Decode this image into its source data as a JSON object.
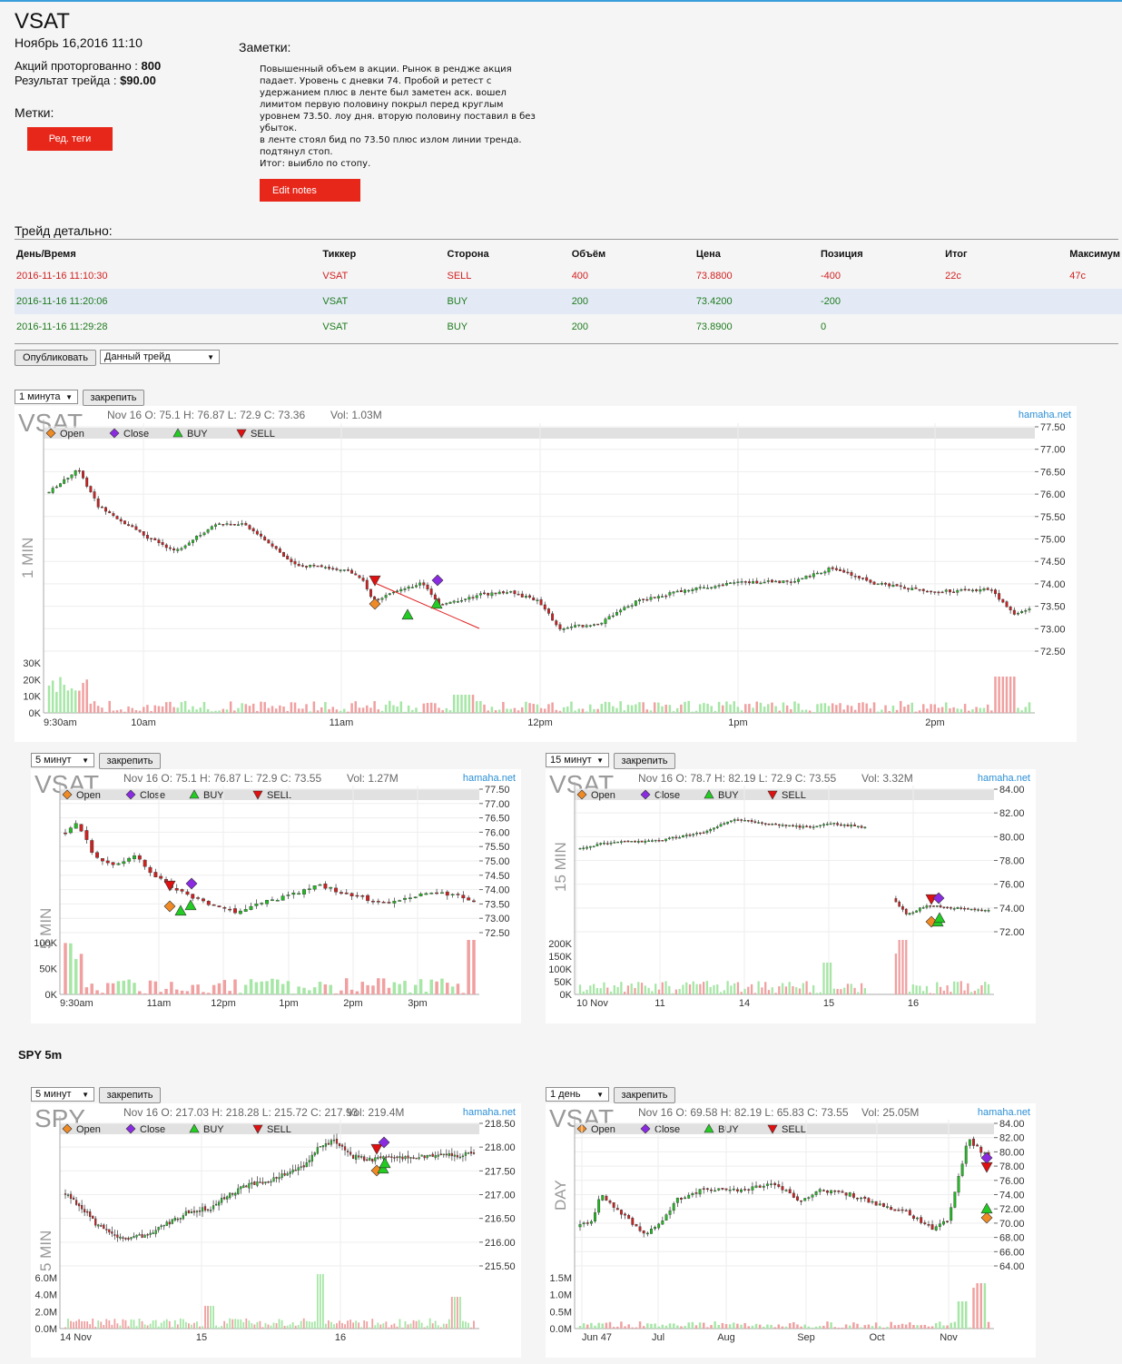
{
  "header": {
    "ticker": "VSAT",
    "datetime": "Ноябрь 16,2016 11:10",
    "shares_label": "Акций проторгованно : ",
    "shares_value": "800",
    "result_label": "Результат трейда : ",
    "result_value": "$90.00",
    "tags_label": "Метки:",
    "edit_tags_button": "Ред. теги"
  },
  "notes": {
    "label": "Заметки:",
    "lines": [
      "Повышенный объем в акции. Рынок в рендже акция",
      "падает. Уровень с дневки 74. Пробой и ретест с",
      "удержанием плюс в ленте был заметен аск. вошел",
      "лимитом первую половину покрыл перед круглым",
      "уровнем 73.50. лоу дня. вторую половину поставил в без",
      "убыток.",
      "в ленте стоял бид по 73.50 плюс излом линии тренда.",
      "подтянул стоп.",
      "Итог: выибло по стопу."
    ],
    "edit_button": "Edit notes"
  },
  "trades": {
    "title": "Трейд детально:",
    "columns": [
      "День/Время",
      "Тиккер",
      "Сторона",
      "Объём",
      "Цена",
      "Позиция",
      "Итог",
      "Максимум"
    ],
    "rows": [
      [
        "2016-11-16 11:10:30",
        "VSAT",
        "SELL",
        "400",
        "73.8800",
        "-400",
        "22c",
        "47c"
      ],
      [
        "2016-11-16 11:20:06",
        "VSAT",
        "BUY",
        "200",
        "73.4200",
        "-200",
        "",
        ""
      ],
      [
        "2016-11-16 11:29:28",
        "VSAT",
        "BUY",
        "200",
        "73.8900",
        "0",
        "",
        ""
      ]
    ]
  },
  "toolbar": {
    "publish_button": "Опубликовать",
    "scope_select": "Данный трейд"
  },
  "pin_label": "закрепить",
  "spy_heading": "SPY 5m",
  "legend": {
    "open": "Open",
    "close": "Close",
    "buy": "BUY",
    "sell": "SELL"
  },
  "colors": {
    "accent_red": "#e8271b",
    "sell": "#d21f1f",
    "buy": "#1e7b1e",
    "candle_up": "#22bb22",
    "candle_down": "#cc2222",
    "brand": "#2a8fd6"
  },
  "charts": [
    {
      "id": "c1",
      "interval": "1 минута",
      "symbol": "VSAT",
      "tf_label": "1 MIN",
      "info": "Nov 16 O: 75.1 H: 76.87 L: 72.9 C: 73.36",
      "vol": "Vol: 1.03M",
      "watermark": "hamaha.net",
      "y_ticks": [
        "77.50",
        "77.00",
        "76.50",
        "76.00",
        "75.50",
        "75.00",
        "74.50",
        "74.00",
        "73.50",
        "73.00",
        "72.50"
      ],
      "vol_ticks": [
        "30K",
        "20K",
        "10K",
        "0K"
      ],
      "x_ticks": [
        "9:30am",
        "10am",
        "11am",
        "12pm",
        "1pm",
        "2pm"
      ]
    },
    {
      "id": "c2",
      "interval": "5 минут",
      "symbol": "VSAT",
      "tf_label": "5 MIN",
      "info": "Nov 16 O: 75.1 H: 76.87 L: 72.9 C: 73.55",
      "vol": "Vol: 1.27M",
      "watermark": "hamaha.net",
      "y_ticks": [
        "77.50",
        "77.00",
        "76.50",
        "76.00",
        "75.50",
        "75.00",
        "74.50",
        "74.00",
        "73.50",
        "73.00",
        "72.50"
      ],
      "vol_ticks": [
        "100K",
        "50K",
        "0K"
      ],
      "x_ticks": [
        "9:30am",
        "11am",
        "12pm",
        "1pm",
        "2pm",
        "3pm"
      ]
    },
    {
      "id": "c3",
      "interval": "15 минут",
      "symbol": "VSAT",
      "tf_label": "15 MIN",
      "info": "Nov 16 O: 78.7 H: 82.19 L: 72.9 C: 73.55",
      "vol": "Vol: 3.32M",
      "watermark": "hamaha.net",
      "y_ticks": [
        "84.00",
        "82.00",
        "80.00",
        "78.00",
        "76.00",
        "74.00",
        "72.00"
      ],
      "vol_ticks": [
        "200K",
        "150K",
        "100K",
        "50K",
        "0K"
      ],
      "x_ticks": [
        "10 Nov",
        "11",
        "14",
        "15",
        "16"
      ]
    },
    {
      "id": "c4",
      "interval": "5 минут",
      "symbol": "SPY",
      "tf_label": "5 MIN",
      "info": "Nov 16 O: 217.03 H: 218.28 L: 215.72 C: 217.93",
      "vol": "Vol: 219.4M",
      "watermark": "hamaha.net",
      "y_ticks": [
        "218.50",
        "218.00",
        "217.50",
        "217.00",
        "216.50",
        "216.00",
        "215.50"
      ],
      "vol_ticks": [
        "6.0M",
        "4.0M",
        "2.0M",
        "0.0M"
      ],
      "x_ticks": [
        "14 Nov",
        "15",
        "16"
      ]
    },
    {
      "id": "c5",
      "interval": "1 день",
      "symbol": "VSAT",
      "tf_label": "DAY",
      "info": "Nov 16 O: 69.58 H: 82.19 L: 65.83 C: 73.55",
      "vol": "Vol: 25.05M",
      "watermark": "hamaha.net",
      "y_ticks": [
        "84.00",
        "82.00",
        "80.00",
        "78.00",
        "76.00",
        "74.00",
        "72.00",
        "70.00",
        "68.00",
        "66.00",
        "64.00"
      ],
      "vol_ticks": [
        "1.5M",
        "1.0M",
        "0.5M",
        "0.0M"
      ],
      "x_ticks": [
        "Jun 47",
        "Jul",
        "Aug",
        "Sep",
        "Oct",
        "Nov"
      ]
    }
  ]
}
